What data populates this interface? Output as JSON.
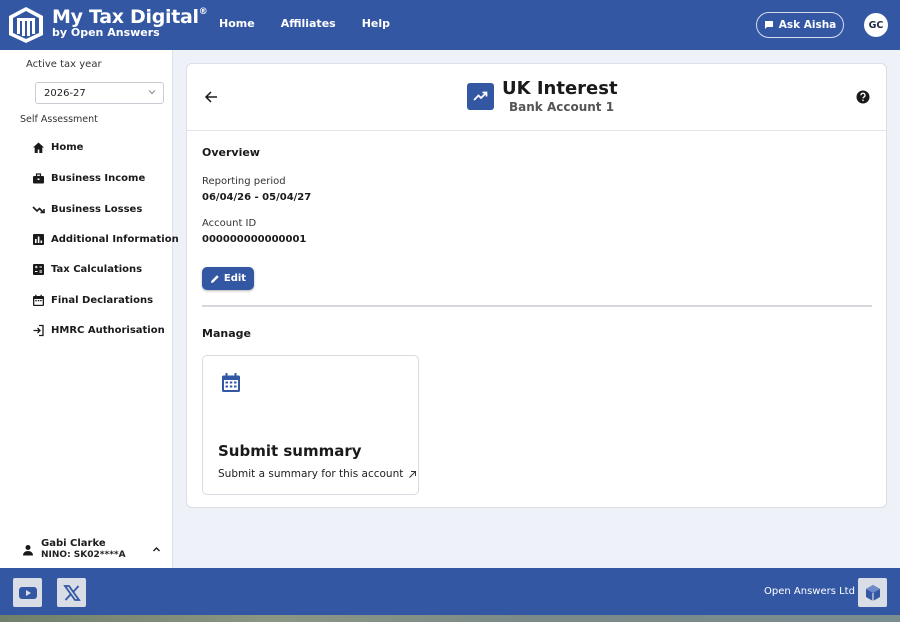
{
  "header": {
    "app_title": "My Tax Digital",
    "app_title_mark": "®",
    "app_subtitle": "by Open Answers",
    "nav": [
      "Home",
      "Affiliates",
      "Help"
    ],
    "ask_label": "Ask Aisha",
    "avatar_initials": "GC"
  },
  "sidebar": {
    "year_label": "Active tax year",
    "year_value": "2026-27",
    "section_label": "Self Assessment",
    "items": [
      {
        "label": "Home",
        "icon": "home-icon"
      },
      {
        "label": "Business Income",
        "icon": "briefcase-icon"
      },
      {
        "label": "Business Losses",
        "icon": "trending-down-icon"
      },
      {
        "label": "Additional Information",
        "icon": "bar-chart-icon"
      },
      {
        "label": "Tax Calculations",
        "icon": "calculator-icon"
      },
      {
        "label": "Final Declarations",
        "icon": "calendar-icon"
      },
      {
        "label": "HMRC Authorisation",
        "icon": "login-icon"
      }
    ],
    "user": {
      "name": "Gabi Clarke",
      "nino": "NINO: SK02****A"
    }
  },
  "main": {
    "title": "UK Interest",
    "subtitle": "Bank Account 1",
    "overview_title": "Overview",
    "reporting_period_label": "Reporting period",
    "reporting_period_value": "06/04/26 - 05/04/27",
    "account_id_label": "Account ID",
    "account_id_value": "000000000000001",
    "edit_label": "Edit",
    "manage_title": "Manage",
    "tile": {
      "title": "Submit summary",
      "description": "Submit a summary for this account"
    }
  },
  "footer": {
    "company": "Open Answers Ltd"
  },
  "colors": {
    "brand": "#3457a4",
    "background": "#eef1f7"
  }
}
